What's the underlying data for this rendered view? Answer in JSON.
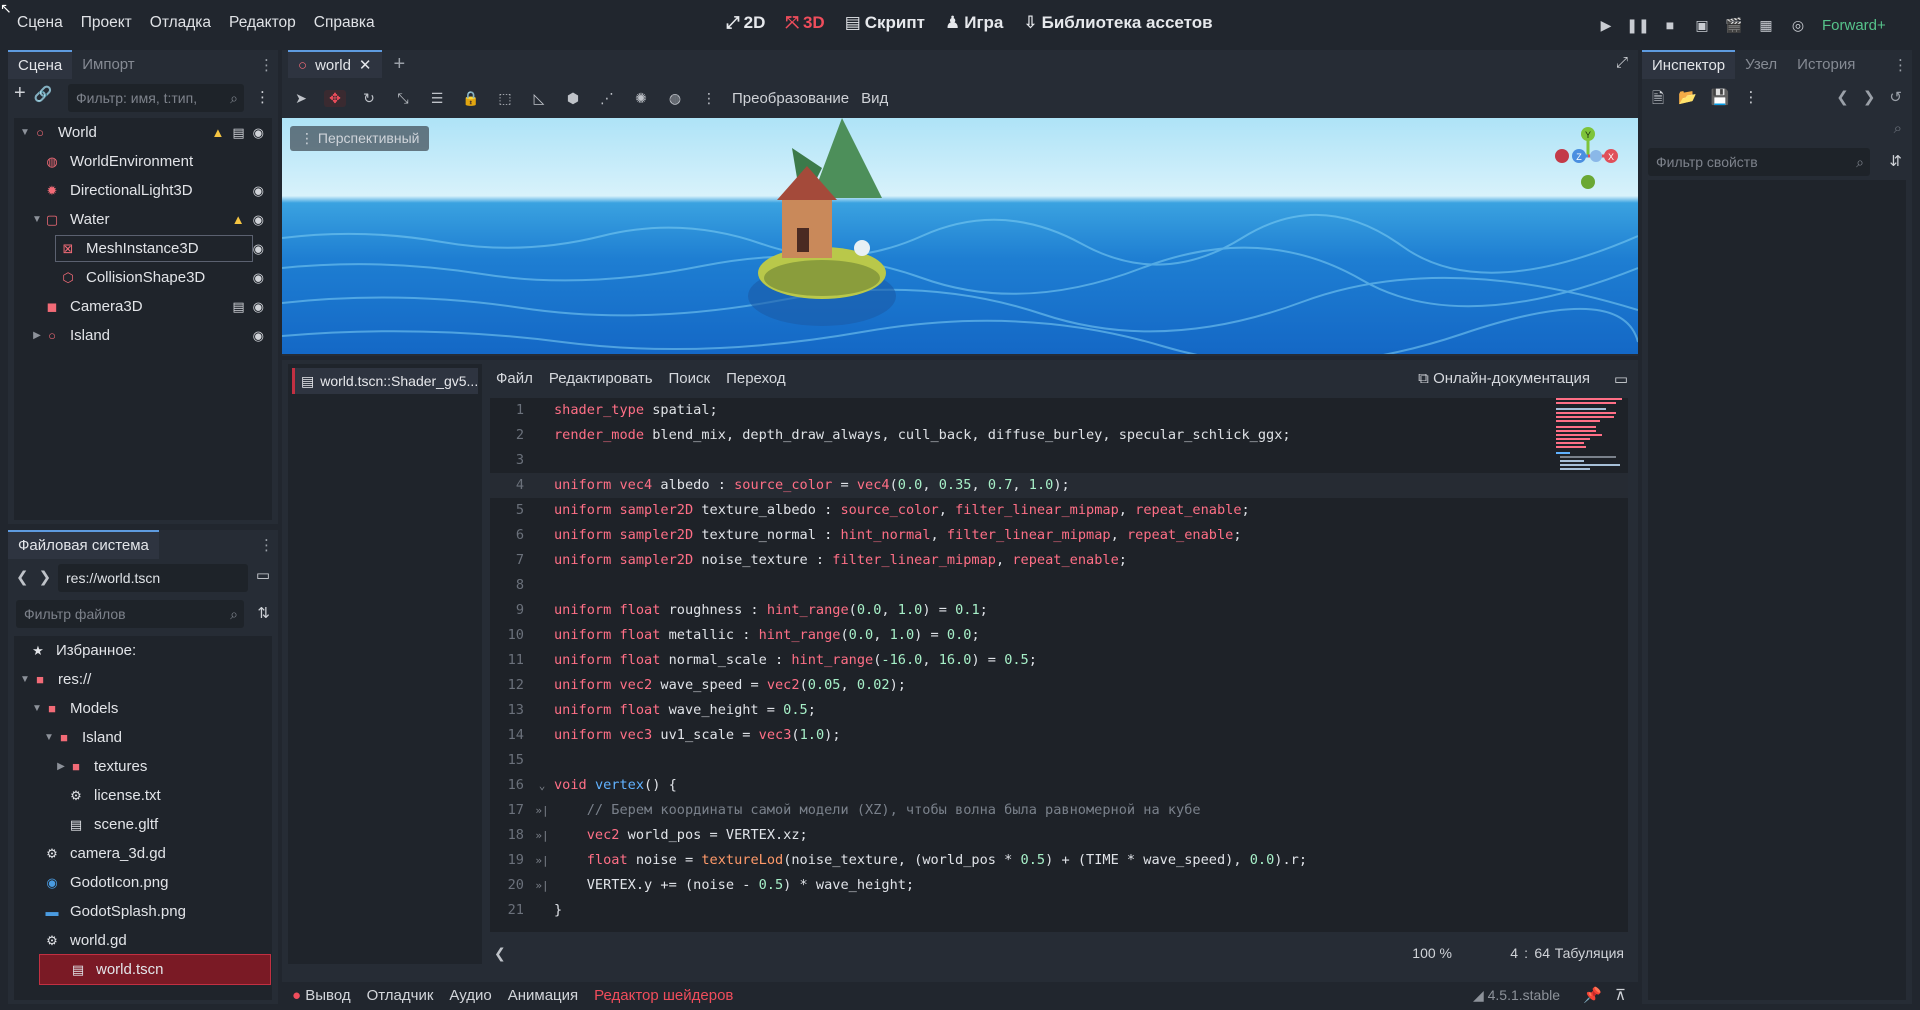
{
  "menu": [
    "Сцена",
    "Проект",
    "Отладка",
    "Редактор",
    "Справка"
  ],
  "modes": [
    {
      "label": "2D",
      "icon": "2d-icon"
    },
    {
      "label": "3D",
      "icon": "3d-icon"
    },
    {
      "label": "Скрипт",
      "icon": "script-icon"
    },
    {
      "label": "Игра",
      "icon": "game-icon"
    },
    {
      "label": "Библиотека ассетов",
      "icon": "asset-library-icon"
    }
  ],
  "renderer": "Forward+",
  "scene_dock": {
    "tabs": [
      "Сцена",
      "Импорт"
    ],
    "filter_placeholder": "Фильтр: имя, t:тип,",
    "nodes": [
      {
        "label": "World",
        "icon": "node3d-icon",
        "warn": true,
        "script": true,
        "visible": true
      },
      {
        "label": "WorldEnvironment",
        "icon": "environment-icon"
      },
      {
        "label": "DirectionalLight3D",
        "icon": "light-icon",
        "visible": true
      },
      {
        "label": "Water",
        "icon": "water-icon",
        "warn": true,
        "visible": true
      },
      {
        "label": "MeshInstance3D",
        "icon": "mesh-icon",
        "visible": true
      },
      {
        "label": "CollisionShape3D",
        "icon": "collision-icon",
        "visible": true
      },
      {
        "label": "Camera3D",
        "icon": "camera-icon",
        "script": true,
        "visible": true
      },
      {
        "label": "Island",
        "icon": "node3d-icon",
        "visible": true
      }
    ]
  },
  "filesystem": {
    "title": "Файловая система",
    "path": "res://world.tscn",
    "filter_placeholder": "Фильтр файлов",
    "favorites": "Избранное:",
    "items": [
      "res://",
      "Models",
      "Island",
      "textures",
      "license.txt",
      "scene.gltf",
      "camera_3d.gd",
      "GodotIcon.png",
      "GodotSplash.png",
      "world.gd",
      "world.tscn"
    ]
  },
  "editor_tab": "world",
  "viewport": {
    "toolbar_labels": [
      "Преобразование",
      "Вид"
    ],
    "perspective": "Перспективный",
    "gizmo": {
      "y": "Y",
      "z": "Z",
      "x": "X"
    }
  },
  "shader": {
    "file": "world.tscn::Shader_gv5...",
    "menu": [
      "Файл",
      "Редактировать",
      "Поиск",
      "Переход"
    ],
    "online_docs": "Онлайн-документация",
    "zoom": "100 %",
    "line": "4",
    "col": "64",
    "indent": "Табуляция"
  },
  "bottom": {
    "tabs": [
      "Вывод",
      "Отладчик",
      "Аудио",
      "Анимация",
      "Редактор шейдеров"
    ],
    "version": "4.5.1.stable"
  },
  "inspector": {
    "tabs": [
      "Инспектор",
      "Узел",
      "История"
    ],
    "filter_placeholder": "Фильтр свойств"
  },
  "colors": {
    "accent": "#5e9be0",
    "error": "#f04d5c",
    "warning": "#f5c542",
    "renderer": "#56c38b"
  }
}
